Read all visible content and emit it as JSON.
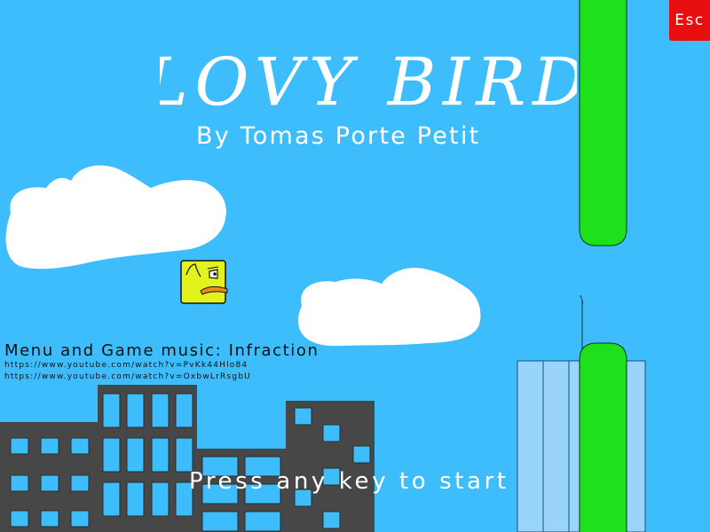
{
  "game": {
    "title": "LOVY BIRD",
    "author_line": "By Tomas Porte Petit",
    "music_credit": "Menu and Game music: Infraction",
    "music_links": [
      "https://www.youtube.com/watch?v=PvKk44Hlo84",
      "https://www.youtube.com/watch?v=OxbwLrRsgbU"
    ],
    "start_prompt": "Press any key to start",
    "esc_label": "Esc"
  },
  "colors": {
    "sky": "#3dbdfb",
    "cloud": "#ffffff",
    "pipe": "#1ee01b",
    "building_dark": "#474747",
    "window_blue": "#3dbdfb",
    "tower_blue": "#99d4fc",
    "bird_yellow": "#e3f21b",
    "bird_beak": "#f08c1c",
    "esc_red": "#e80f10"
  },
  "icons": {
    "bird": "bird-icon",
    "esc": "esc-icon"
  }
}
